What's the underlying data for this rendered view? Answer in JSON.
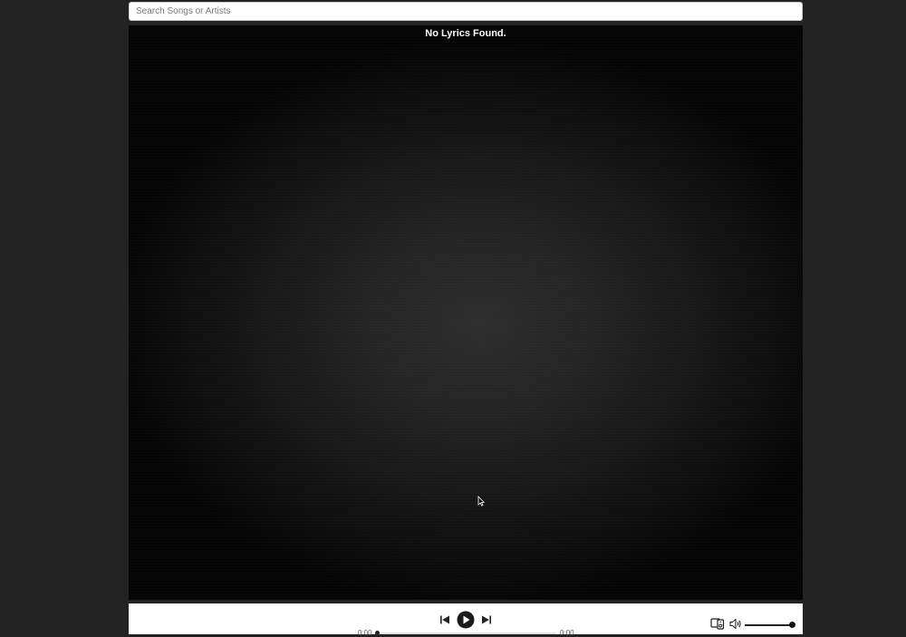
{
  "search": {
    "placeholder": "Search Songs or Artists",
    "value": ""
  },
  "lyrics": {
    "message": "No Lyrics Found."
  },
  "player": {
    "time_current": "0:00",
    "time_total": "0:00",
    "progress_fraction": 0,
    "volume_fraction": 1,
    "icons": {
      "previous": "skip-back-icon",
      "play": "play-icon",
      "next": "skip-forward-icon",
      "devices": "devices-icon",
      "volume": "volume-icon"
    }
  },
  "colors": {
    "page_background": "#232323",
    "player_background": "#ffffff",
    "text_primary": "#ffffff"
  }
}
